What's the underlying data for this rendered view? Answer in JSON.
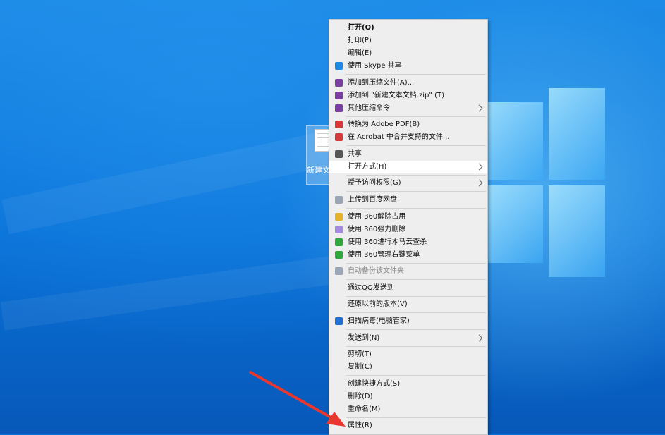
{
  "desktop": {
    "file_label": "新建文本文档.txt"
  },
  "menu": {
    "groups": [
      {
        "items": [
          {
            "label": "打开(O)",
            "bold": true
          },
          {
            "label": "打印(P)"
          },
          {
            "label": "编辑(E)"
          },
          {
            "label": "使用 Skype 共享",
            "icon": "skype-icon"
          }
        ]
      },
      {
        "items": [
          {
            "label": "添加到压缩文件(A)...",
            "icon": "winrar-icon"
          },
          {
            "label": "添加到 \"新建文本文档.zip\" (T)",
            "icon": "winrar-icon"
          },
          {
            "label": "其他压缩命令",
            "icon": "winrar-icon",
            "submenu": true
          }
        ]
      },
      {
        "items": [
          {
            "label": "转换为 Adobe PDF(B)",
            "icon": "acrobat-icon"
          },
          {
            "label": "在 Acrobat 中合并支持的文件...",
            "icon": "acrobat-icon"
          }
        ]
      },
      {
        "items": [
          {
            "label": "共享",
            "icon": "share-icon"
          },
          {
            "label": "打开方式(H)",
            "submenu": true,
            "highlighted": true
          }
        ]
      },
      {
        "items": [
          {
            "label": "授予访问权限(G)",
            "submenu": true
          }
        ]
      },
      {
        "items": [
          {
            "label": "上传到百度网盘",
            "icon": "baidu-cloud-icon"
          }
        ]
      },
      {
        "items": [
          {
            "label": "使用 360解除占用",
            "icon": "360-unlock-icon"
          },
          {
            "label": "使用 360强力删除",
            "icon": "360-delete-icon"
          },
          {
            "label": "使用 360进行木马云查杀",
            "icon": "360-scan-icon"
          },
          {
            "label": "使用 360管理右键菜单",
            "icon": "360-menu-icon"
          }
        ]
      },
      {
        "items": [
          {
            "label": "自动备份该文件夹",
            "icon": "backup-icon",
            "disabled": true
          }
        ]
      },
      {
        "items": [
          {
            "label": "通过QQ发送到"
          }
        ]
      },
      {
        "items": [
          {
            "label": "还原以前的版本(V)"
          }
        ]
      },
      {
        "items": [
          {
            "label": "扫描病毒(电脑管家)",
            "icon": "tencent-shield-icon"
          }
        ]
      },
      {
        "items": [
          {
            "label": "发送到(N)",
            "submenu": true
          }
        ]
      },
      {
        "items": [
          {
            "label": "剪切(T)"
          },
          {
            "label": "复制(C)"
          }
        ]
      },
      {
        "items": [
          {
            "label": "创建快捷方式(S)"
          },
          {
            "label": "删除(D)"
          },
          {
            "label": "重命名(M)"
          }
        ]
      },
      {
        "items": [
          {
            "label": "属性(R)"
          }
        ]
      }
    ]
  },
  "colors": {
    "skype-icon": "#1e88e5",
    "winrar-icon": "#7a3fa0",
    "acrobat-icon": "#d33a3a",
    "share-icon": "#555555",
    "baidu-cloud-icon": "#9aa6b5",
    "360-unlock-icon": "#e5b22a",
    "360-delete-icon": "#a48be0",
    "360-scan-icon": "#2ea83a",
    "360-menu-icon": "#2ea83a",
    "backup-icon": "#9aa6b5",
    "tencent-shield-icon": "#1f6fd6",
    "annotation_arrow": "#e8372f"
  }
}
